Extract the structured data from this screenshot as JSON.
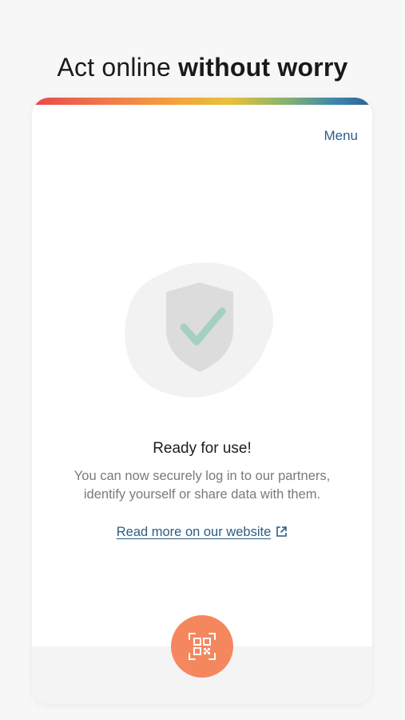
{
  "header": {
    "headline_regular": "Act online ",
    "headline_bold": "without worry"
  },
  "screen": {
    "menu_label": "Menu",
    "status_title": "Ready for use!",
    "description": "You can now securely log in to our partners, identify yourself or share data with them.",
    "read_more_label": "Read more on our website"
  },
  "icons": {
    "illustration": "shield-check-icon",
    "external_link": "external-link-icon",
    "scan": "qr-scan-icon"
  },
  "colors": {
    "accent_link": "#2b5d84",
    "scan_button": "#f5875f",
    "check_mark": "#a5cfc3"
  }
}
